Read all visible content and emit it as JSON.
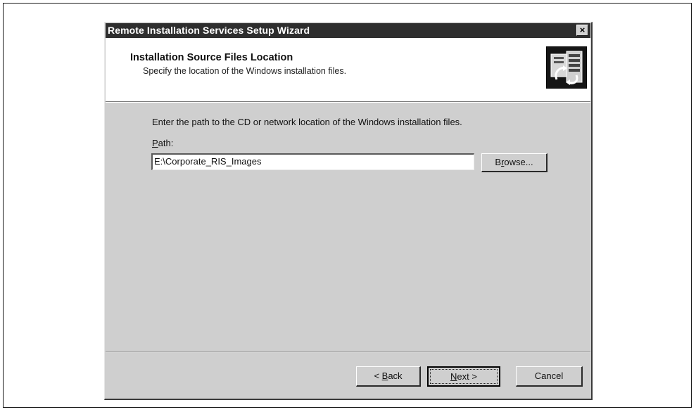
{
  "window": {
    "title": "Remote Installation Services Setup Wizard",
    "close_glyph": "×"
  },
  "header": {
    "title": "Installation Source Files Location",
    "subtitle": "Specify the location of the Windows installation files.",
    "icon": "wizard-setup-icon"
  },
  "body": {
    "instruction": "Enter the path to the CD or network location of the Windows installation files.",
    "path_label_mnemonic": "P",
    "path_label_rest": "ath:",
    "path_value": "E:\\Corporate_RIS_Images",
    "browse_mnemonic_pre": "B",
    "browse_mnemonic": "r",
    "browse_rest": "owse..."
  },
  "footer": {
    "back_pre": "< ",
    "back_mnemonic": "B",
    "back_rest": "ack",
    "next_mnemonic": "N",
    "next_rest": "ext >",
    "cancel_label": "Cancel"
  }
}
